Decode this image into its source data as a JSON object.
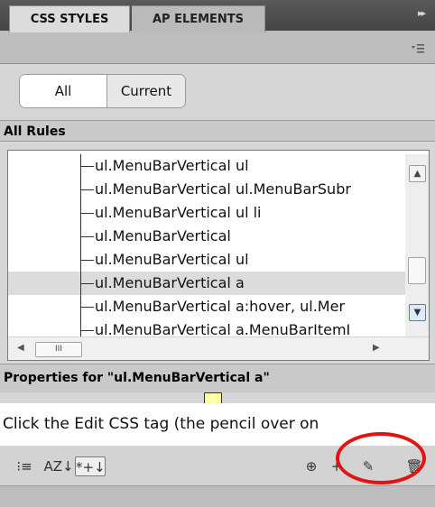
{
  "panel": {
    "collapse_glyph": "▸▸",
    "tabs": [
      {
        "label": "CSS STYLES"
      },
      {
        "label": "AP ELEMENTS"
      }
    ],
    "menu_icon": "panel-menu-icon",
    "mode": {
      "all": "All",
      "current": "Current",
      "selected": "All"
    },
    "rules_header": "All Rules",
    "rules": [
      {
        "text": "ul.MenuBarVertical ul"
      },
      {
        "text": "ul.MenuBarVertical ul.MenuBarSubr"
      },
      {
        "text": "ul.MenuBarVertical ul li"
      },
      {
        "text": "ul.MenuBarVertical"
      },
      {
        "text": "ul.MenuBarVertical ul"
      },
      {
        "text": "ul.MenuBarVertical a",
        "selected": true
      },
      {
        "text": "ul.MenuBarVertical a:hover, ul.Mer"
      },
      {
        "text": "ul.MenuBarVertical a.MenuBarItemI"
      }
    ],
    "hscroll_grip": "III",
    "properties_header": "Properties for \"ul.MenuBarVertical a\""
  },
  "caption": "Click the Edit CSS tag (the pencil over on",
  "toolbar": {
    "category_view": "⁝≡",
    "alpha_view": "AZ↓",
    "set_properties": "*+↓",
    "attach": "⊕",
    "new_rule": "+",
    "edit": "✎",
    "delete": "🗑"
  },
  "colors": {
    "highlight_circle": "#e11414",
    "selected_row": "#dcdcdc"
  }
}
